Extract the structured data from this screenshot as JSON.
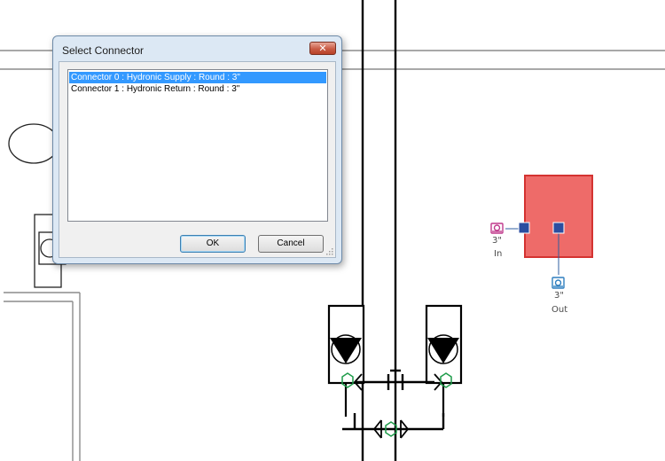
{
  "dialog": {
    "title": "Select Connector",
    "close_glyph": "✕",
    "items": [
      {
        "label": "Connector 0 : Hydronic Supply : Round : 3\"",
        "selected": true
      },
      {
        "label": "Connector 1 : Hydronic Return : Round : 3\"",
        "selected": false
      }
    ],
    "ok_label": "OK",
    "cancel_label": "Cancel"
  },
  "equipment": {
    "in_size": "3\"",
    "in_label": "In",
    "out_size": "3\"",
    "out_label": "Out",
    "fill_color": "#ee6b69",
    "border_color": "#d43331",
    "in_connector_color": "#c0398c",
    "out_connector_color": "#2f7fbf"
  },
  "piping": {
    "fitting_color": "#1e9c4a"
  }
}
